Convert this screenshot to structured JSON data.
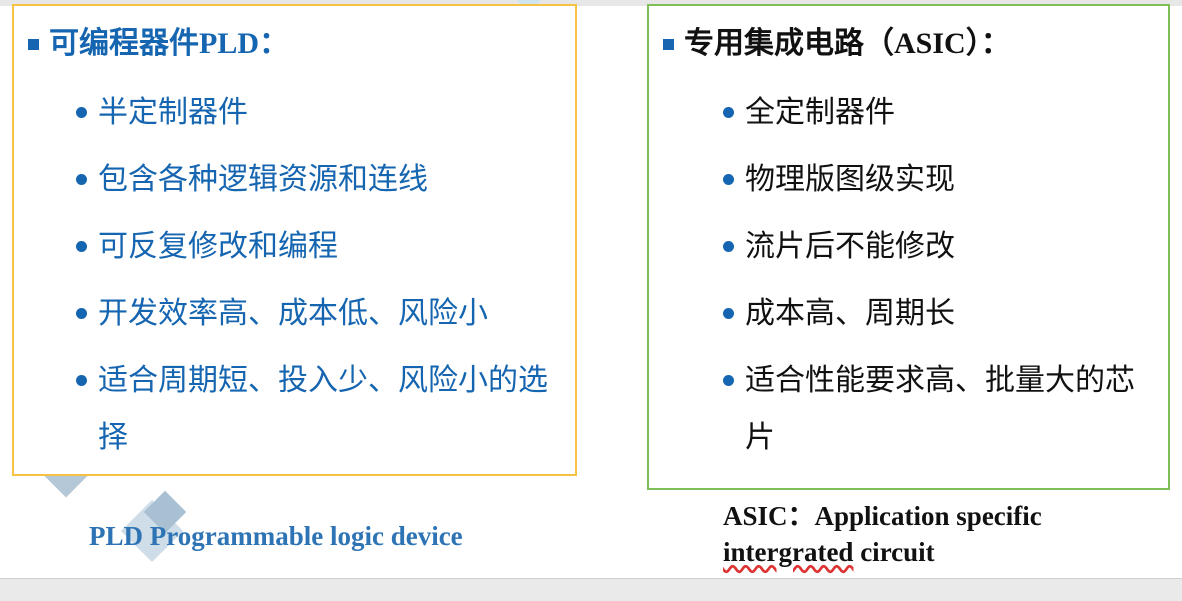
{
  "pld": {
    "heading_cn": "可编程器件",
    "heading_latin": "PLD：",
    "items": [
      "半定制器件",
      "包含各种逻辑资源和连线",
      "可反复修改和编程",
      "开发效率高、成本低、风险小",
      "适合周期短、投入少、风险小的选择"
    ],
    "caption": "PLD  Programmable logic device"
  },
  "asic": {
    "heading_cn": "专用集成电路",
    "heading_latin": "（ASIC）：",
    "items": [
      "全定制器件",
      "物理版图级实现",
      "流片后不能修改",
      "成本高、周期长",
      "适合性能要求高、批量大的芯片"
    ],
    "caption_line1": "ASIC：Application specific",
    "caption_word": "intergrated",
    "caption_rest": " circuit"
  },
  "colors": {
    "accent_blue": "#1565b0",
    "pld_border": "#f5c244",
    "asic_border": "#7fbf58",
    "caption_blue": "#2e74b5"
  }
}
